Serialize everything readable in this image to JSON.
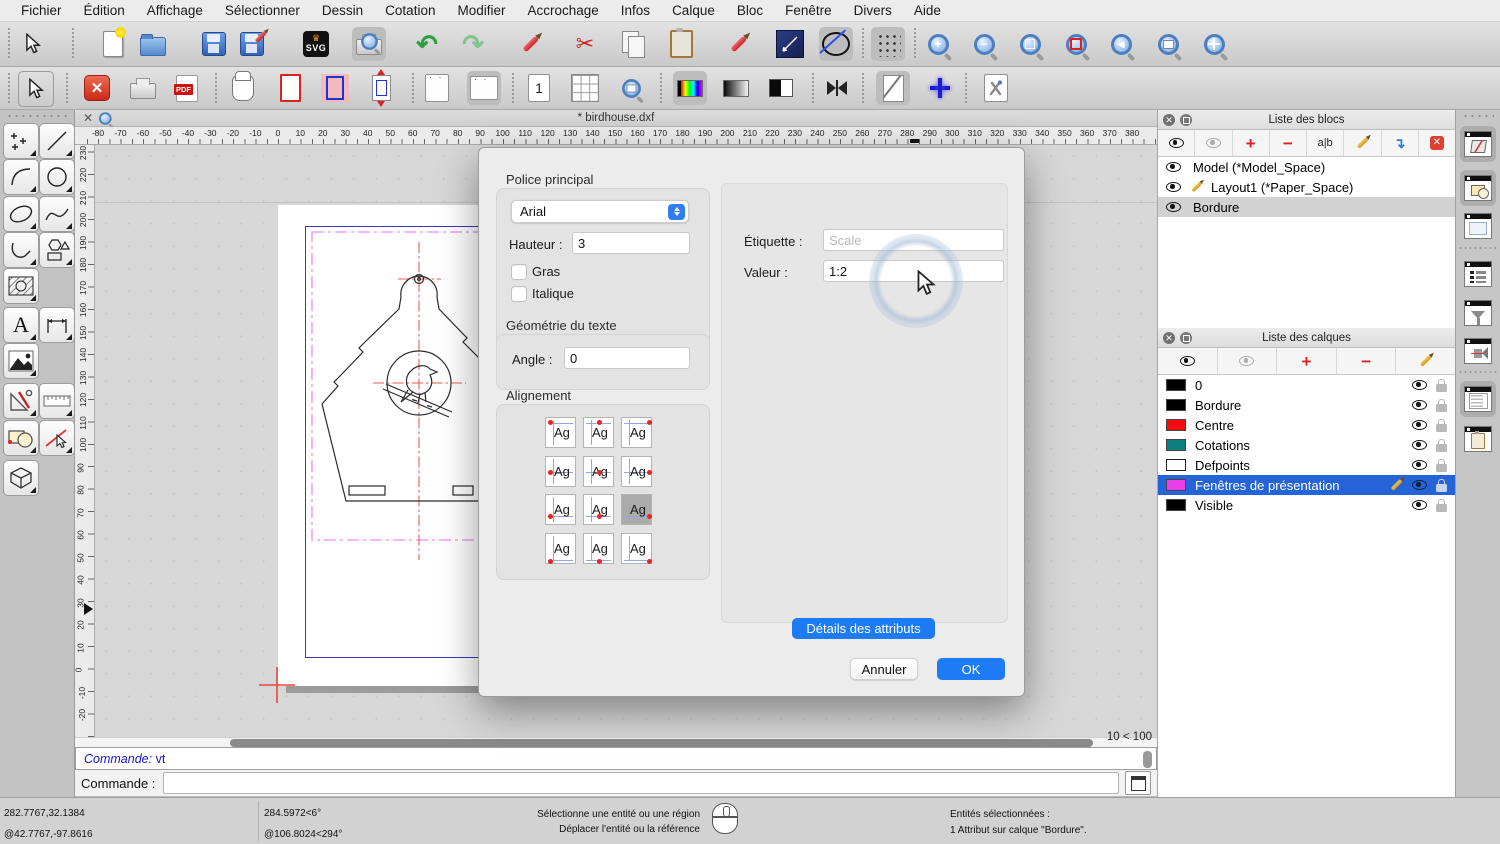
{
  "window": {
    "tab_title": "* birdhouse.dxf",
    "zoom_info": "10 < 100"
  },
  "menu": {
    "items": [
      "Fichier",
      "Édition",
      "Affichage",
      "Sélectionner",
      "Dessin",
      "Cotation",
      "Modifier",
      "Accrochage",
      "Infos",
      "Calque",
      "Bloc",
      "Fenêtre",
      "Divers",
      "Aide"
    ]
  },
  "toolbar": {
    "svg_label": "SVG",
    "pdf_label": "PDF",
    "one_label": "1"
  },
  "rulers": {
    "h_labels": [
      "-80",
      "-70",
      "-60",
      "-50",
      "-40",
      "-30",
      "-20",
      "-10",
      "0",
      "10",
      "20",
      "30",
      "40",
      "50",
      "60",
      "70",
      "80",
      "90",
      "100",
      "110",
      "120",
      "130",
      "140",
      "150",
      "160",
      "170",
      "180",
      "190",
      "200",
      "210",
      "220",
      "230",
      "240",
      "250",
      "260",
      "270",
      "280",
      "290",
      "300",
      "310",
      "320",
      "330",
      "340",
      "350",
      "360",
      "370",
      "380"
    ],
    "v_labels": [
      "230",
      "220",
      "210",
      "200",
      "190",
      "180",
      "170",
      "160",
      "150",
      "140",
      "130",
      "120",
      "110",
      "100",
      "90",
      "80",
      "70",
      "60",
      "50",
      "40",
      "30",
      "20",
      "10",
      "0",
      "-10",
      "-20"
    ]
  },
  "dialog": {
    "font_section": "Police principal",
    "font_name": "Arial",
    "height_label": "Hauteur :",
    "height_value": "3",
    "bold_label": "Gras",
    "italic_label": "Italique",
    "geometry_section": "Géométrie du texte",
    "angle_label": "Angle :",
    "angle_value": "0",
    "alignment_section": "Alignement",
    "alignment_sample": "Ag",
    "alignment_selected_index": 8,
    "tag_label": "Étiquette :",
    "tag_placeholder": "Scale",
    "value_label": "Valeur :",
    "value_text": "1:2",
    "details_button": "Détails des attributs",
    "cancel_button": "Annuler",
    "ok_button": "OK"
  },
  "blocks_panel": {
    "title": "Liste des blocs",
    "rename_label": "a|b",
    "rows": [
      {
        "name": "Model (*Model_Space)",
        "pencil": false,
        "selected": false
      },
      {
        "name": "Layout1 (*Paper_Space)",
        "pencil": true,
        "selected": false
      },
      {
        "name": "Bordure",
        "pencil": false,
        "selected": true
      }
    ]
  },
  "layers_panel": {
    "title": "Liste des calques",
    "rows": [
      {
        "color": "#000000",
        "name": "0",
        "selected": false,
        "pencil": false
      },
      {
        "color": "#000000",
        "name": "Bordure",
        "selected": false,
        "pencil": false
      },
      {
        "color": "#f20d0d",
        "name": "Centre",
        "selected": false,
        "pencil": false
      },
      {
        "color": "#0e7f7f",
        "name": "Cotations",
        "selected": false,
        "pencil": false
      },
      {
        "color": "#ffffff",
        "name": "Defpoints",
        "selected": false,
        "pencil": false
      },
      {
        "color": "#e93fe9",
        "name": "Fenêtres de présentation",
        "selected": true,
        "pencil": true
      },
      {
        "color": "#000000",
        "name": "Visible",
        "selected": false,
        "pencil": false
      }
    ]
  },
  "command": {
    "history_prefix": "Commande:",
    "history_value": " vt",
    "prompt_label": "Commande :"
  },
  "statusbar": {
    "abs_coord": "282.7767,32.1384",
    "rel_coord": "@42.7767,-97.8616",
    "polar_abs": "284.5972<6°",
    "polar_rel": "@106.8024<294°",
    "hint_line1": "Sélectionne une entité ou une région",
    "hint_line2": "Déplacer l'entité ou la référence",
    "selection_line1": "Entités sélectionnées :",
    "selection_line2": "1 Attribut sur calque \"Bordure\"."
  },
  "colors": {
    "accent_blue": "#1d7bf5",
    "selection_blue": "#2563d9",
    "paper_border_blue": "#3a3ab0",
    "viewport_magenta": "#f39ff3",
    "centerline_red": "#ef5a4f",
    "origin_red": "#f04438"
  },
  "icons": {
    "undo": "↶",
    "redo": "↷",
    "scissors": "✂",
    "close": "×",
    "zoom_in": "+",
    "zoom_out": "−",
    "zoom_left": "◀"
  }
}
